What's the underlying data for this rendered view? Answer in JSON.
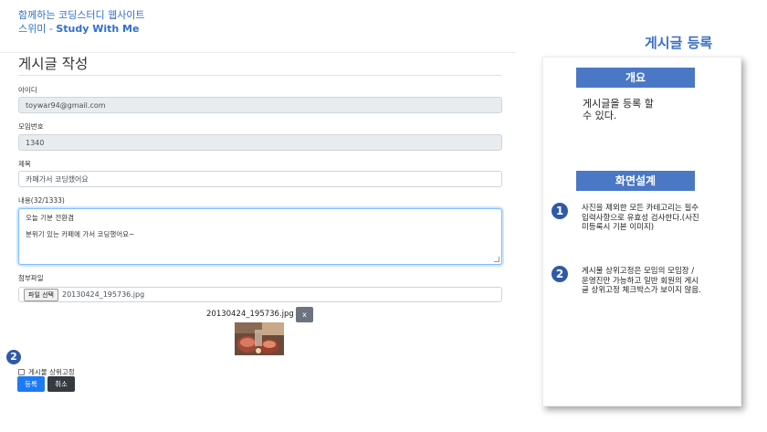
{
  "site": {
    "title": "함께하는 코딩스터디 웹사이트",
    "name_kr": "스위미 - ",
    "name_en": "Study With Me"
  },
  "form": {
    "heading": "게시글 작성",
    "id_label": "아이디",
    "id_value": "toywar94@gmail.com",
    "group_label": "모임번호",
    "group_value": "1340",
    "title_label": "제목",
    "title_value": "카페가서 코딩했어요",
    "content_label": "내용(32/1333)",
    "content_line1": "오늘 기분 전환겸",
    "content_line2": "분위기 있는 카페에 가서 코딩했어요~",
    "file_label": "첨부파일",
    "file_button": "파일 선택",
    "file_name": "20130424_195736.jpg",
    "preview_name": "20130424_195736.jpg",
    "remove_button": "x",
    "pin_label": "게시물 상위고정",
    "pin_checked": false,
    "submit_button": "등록",
    "cancel_button": "취소",
    "marker_2": "2"
  },
  "panel": {
    "heading": "게시글 등록",
    "overview_title": "개요",
    "overview_line1": "게시글을 등록 할",
    "overview_line2": "수 있다.",
    "design_title": "화면설계",
    "note1_marker": "1",
    "note1_text": "사진을 제외한 모든 카테고리는 필수입력사항으로 유효성 검사한다.(사진 미등록시 기본 이미지)",
    "note2_marker": "2",
    "note2_text": "게시물 상위고정은 모임의 모임장 / 운영진만 가능하고 일반 회원의 게시글 상위고정 체크박스가 보이지 않음."
  },
  "colors": {
    "accent": "#3b6fc6",
    "primary_button": "#1d7bf2",
    "dark_button": "#343a40",
    "marker": "#2f5aa8"
  }
}
